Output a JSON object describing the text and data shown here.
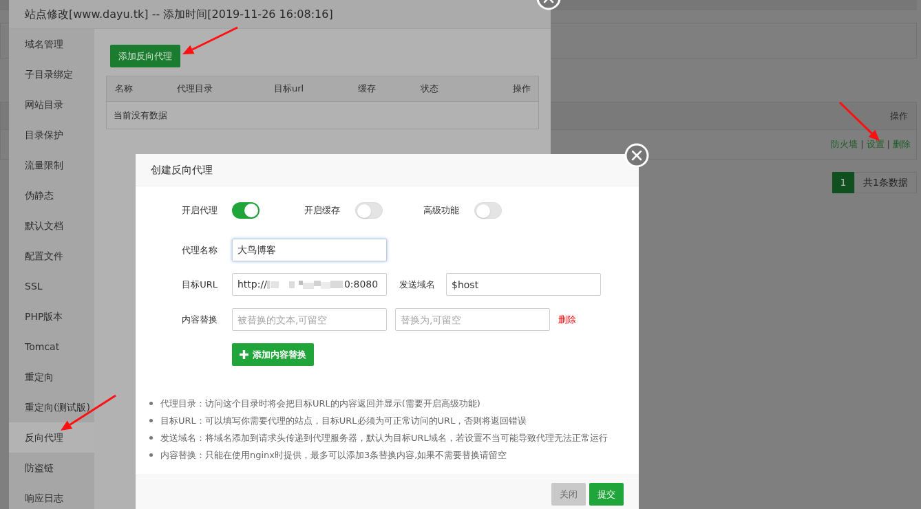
{
  "background_page": {
    "table": {
      "columns": [
        "操作"
      ],
      "rows": [
        {
          "actions": [
            "防火墙",
            "设置",
            "删除"
          ],
          "separator": "|"
        }
      ]
    },
    "pagination": {
      "pages": [
        {
          "label": "1",
          "selected": true
        }
      ],
      "total": "共1条数据"
    }
  },
  "site_dialog": {
    "title": "站点修改[www.dayu.tk] -- 添加时间[2019-11-26 16:08:16]",
    "sidebar": {
      "items": [
        {
          "label": "域名管理",
          "selected": false
        },
        {
          "label": "子目录绑定",
          "selected": false
        },
        {
          "label": "网站目录",
          "selected": false
        },
        {
          "label": "目录保护",
          "selected": false
        },
        {
          "label": "流量限制",
          "selected": false
        },
        {
          "label": "伪静态",
          "selected": false
        },
        {
          "label": "默认文档",
          "selected": false
        },
        {
          "label": "配置文件",
          "selected": false
        },
        {
          "label": "SSL",
          "selected": false
        },
        {
          "label": "PHP版本",
          "selected": false
        },
        {
          "label": "Tomcat",
          "selected": false
        },
        {
          "label": "重定向",
          "selected": false
        },
        {
          "label": "重定向(测试版)",
          "selected": false
        },
        {
          "label": "反向代理",
          "selected": true
        },
        {
          "label": "防盗链",
          "selected": false
        },
        {
          "label": "响应日志",
          "selected": false
        }
      ]
    },
    "add_button": "添加反向代理",
    "table": {
      "columns": [
        "名称",
        "代理目录",
        "目标url",
        "缓存",
        "状态",
        "操作"
      ],
      "empty_text": "当前没有数据"
    }
  },
  "proxy_dialog": {
    "title": "创建反向代理",
    "toggles": [
      {
        "label": "开启代理",
        "on": true
      },
      {
        "label": "开启缓存",
        "on": false
      },
      {
        "label": "高级功能",
        "on": false
      }
    ],
    "name_field": {
      "label": "代理名称",
      "value": "大鸟博客",
      "focused": true
    },
    "url_field": {
      "label": "目标URL",
      "value_parts": [
        "http://",
        "0:8080"
      ]
    },
    "host_field": {
      "label": "发送域名",
      "value": "$host"
    },
    "replace": {
      "label": "内容替换",
      "rows": [
        {
          "from_placeholder": "被替换的文本,可留空",
          "to_placeholder": "替换为,可留空",
          "delete": "删除"
        }
      ]
    },
    "add_replace_button": "添加内容替换",
    "notes": [
      "代理目录：访问这个目录时将会把目标URL的内容返回并显示(需要开启高级功能)",
      "目标URL：可以填写你需要代理的站点，目标URL必须为可正常访问的URL，否则将返回错误",
      "发送域名：将域名添加到请求头传递到代理服务器，默认为目标URL域名，若设置不当可能导致代理无法正常运行",
      "内容替换：只能在使用nginx时提供，最多可以添加3条替换内容,如果不需要替换请留空"
    ],
    "buttons": [
      {
        "label": "关闭",
        "disabled": true
      },
      {
        "label": "提交",
        "disabled": false
      }
    ]
  }
}
